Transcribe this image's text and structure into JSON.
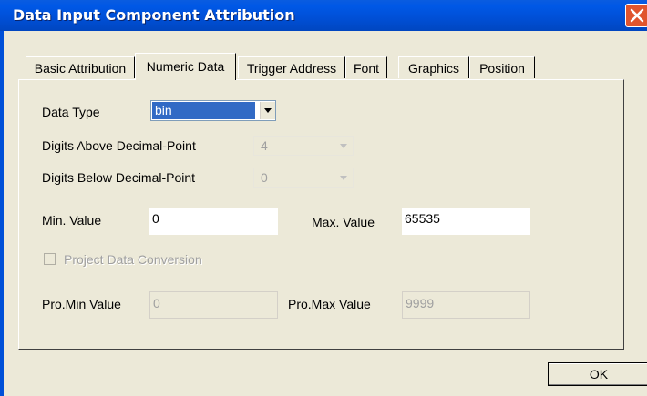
{
  "window": {
    "title": "Data Input Component Attribution"
  },
  "tabs": [
    {
      "label": "Basic Attribution",
      "active": false
    },
    {
      "label": "Numeric Data",
      "active": true
    },
    {
      "label": "Trigger Address",
      "active": false
    },
    {
      "label": "Font",
      "active": false
    },
    {
      "label": "Graphics",
      "active": false
    },
    {
      "label": "Position",
      "active": false
    }
  ],
  "form": {
    "data_type_label": "Data Type",
    "data_type_value": "bin",
    "digits_above_label": "Digits Above Decimal-Point",
    "digits_above_value": "4",
    "digits_below_label": "Digits Below Decimal-Point",
    "digits_below_value": "0",
    "min_label": "Min. Value",
    "min_value": "0",
    "max_label": "Max. Value",
    "max_value": "65535",
    "project_conversion_label": "Project Data Conversion",
    "project_conversion_checked": false,
    "pro_min_label": "Pro.Min Value",
    "pro_min_value": "0",
    "pro_max_label": "Pro.Max Value",
    "pro_max_value": "9999"
  },
  "buttons": {
    "ok_label": "OK"
  },
  "colors": {
    "title_bar": "#0050d8",
    "dialog_bg": "#ece9d8",
    "selection": "#316ac5",
    "close_button": "#e0552e"
  },
  "icons": {
    "close": "close-icon",
    "dropdown": "chevron-down-icon"
  }
}
